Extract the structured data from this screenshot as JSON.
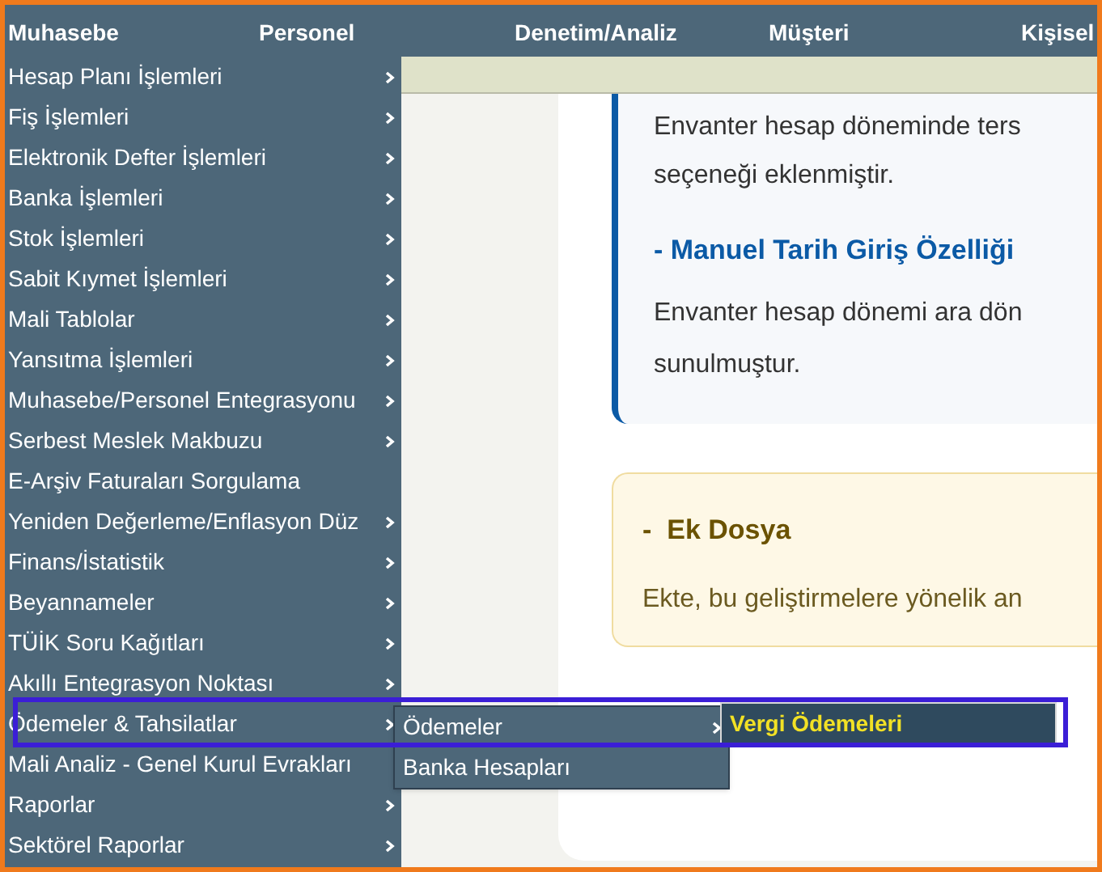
{
  "top_nav": [
    {
      "label": "Muhasebe"
    },
    {
      "label": "Personel"
    },
    {
      "label": "Denetim/Analiz"
    },
    {
      "label": "Müşteri"
    },
    {
      "label": "Kişisel"
    }
  ],
  "menu": [
    {
      "label": "Hesap Planı İşlemleri",
      "submenu": true
    },
    {
      "label": "Fiş İşlemleri",
      "submenu": true
    },
    {
      "label": "Elektronik Defter İşlemleri",
      "submenu": true
    },
    {
      "label": "Banka İşlemleri",
      "submenu": true
    },
    {
      "label": "Stok İşlemleri",
      "submenu": true
    },
    {
      "label": "Sabit Kıymet İşlemleri",
      "submenu": true
    },
    {
      "label": "Mali Tablolar",
      "submenu": true
    },
    {
      "label": "Yansıtma İşlemleri",
      "submenu": true
    },
    {
      "label": "Muhasebe/Personel Entegrasyonu",
      "submenu": true
    },
    {
      "label": "Serbest Meslek Makbuzu",
      "submenu": true
    },
    {
      "label": "E-Arşiv Faturaları Sorgulama",
      "submenu": false
    },
    {
      "label": "Yeniden Değerleme/Enflasyon Düz",
      "submenu": true
    },
    {
      "label": "Finans/İstatistik",
      "submenu": true
    },
    {
      "label": "Beyannameler",
      "submenu": true
    },
    {
      "label": "TÜİK Soru Kağıtları",
      "submenu": true
    },
    {
      "label": "Akıllı Entegrasyon Noktası",
      "submenu": true
    },
    {
      "label": "Ödemeler & Tahsilatlar",
      "submenu": true
    },
    {
      "label": "Mali Analiz - Genel Kurul Evrakları",
      "submenu": false
    },
    {
      "label": "Raporlar",
      "submenu": true
    },
    {
      "label": "Sektörel Raporlar",
      "submenu": true
    }
  ],
  "submenu": [
    {
      "label": "Ödemeler",
      "submenu": true
    },
    {
      "label": "Banka Hesapları",
      "submenu": false
    }
  ],
  "submenu_2": [
    {
      "label": "Vergi Ödemeleri",
      "selected": true
    }
  ],
  "info_card": {
    "lines": [
      "Envanter hesap döneminde ters",
      "seçeneği eklenmiştir."
    ],
    "heading": "- Manuel Tarih Giriş Özelliği",
    "body": [
      "Envanter hesap dönemi ara dön",
      "sunulmuştur."
    ]
  },
  "attachment_card": {
    "heading": "-  Ek Dosya",
    "body": "Ekte, bu geliştirmelere yönelik an"
  }
}
